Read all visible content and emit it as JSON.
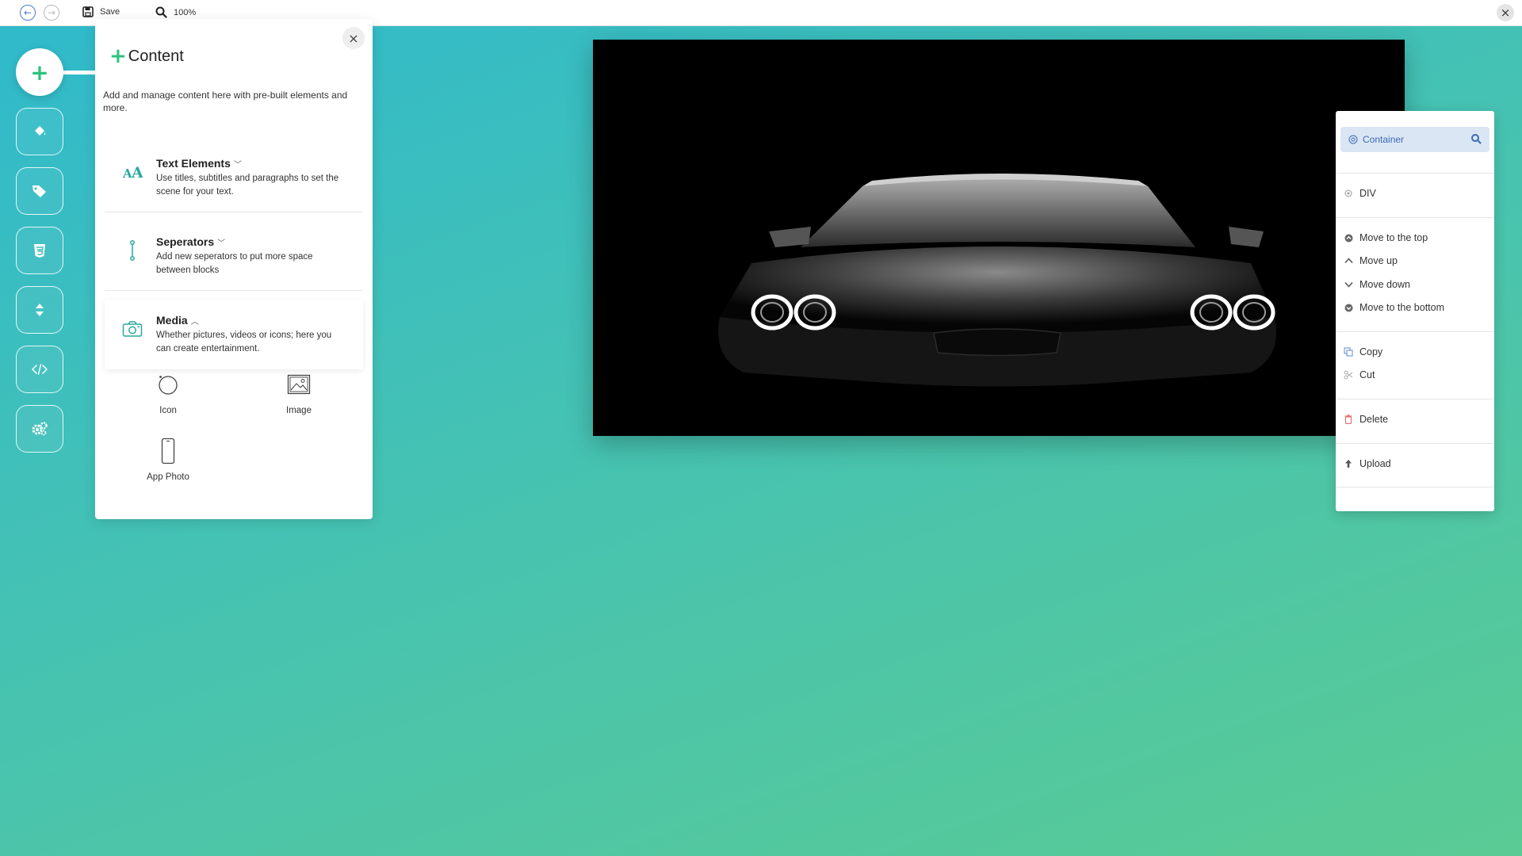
{
  "topbar": {
    "back_icon": "arrow-left-circle-icon",
    "forward_icon": "arrow-right-circle-icon",
    "save_label": "Save",
    "zoom_label": "100%",
    "close_icon": "close-icon"
  },
  "sidebar": {
    "add_icon": "plus-icon",
    "buttons": [
      {
        "name": "paint-bucket-icon"
      },
      {
        "name": "tag-icon"
      },
      {
        "name": "css-icon"
      },
      {
        "name": "sort-arrows-icon"
      },
      {
        "name": "code-icon"
      },
      {
        "name": "settings-gears-icon"
      }
    ]
  },
  "panel": {
    "title": "Content",
    "description": "Add and manage content here with pre-built elements and more.",
    "sections": [
      {
        "title": "Text Elements",
        "description": "Use titles, subtitles and paragraphs to set the scene for your text.",
        "icon": "text-aa-icon",
        "expanded": false
      },
      {
        "title": "Seperators",
        "description": "Add new seperators to put more space between blocks",
        "icon": "separator-icon",
        "expanded": false
      },
      {
        "title": "Media",
        "description": "Whether pictures, videos or icons; here you can create entertainment.",
        "icon": "camera-icon",
        "expanded": true
      }
    ],
    "media_items": [
      {
        "label": "Icon",
        "icon": "circle-icon"
      },
      {
        "label": "Image",
        "icon": "image-icon"
      },
      {
        "label": "App Photo",
        "icon": "phone-icon"
      }
    ]
  },
  "canvas": {
    "image_subject": "car-front-headlights-dark"
  },
  "context_menu": {
    "search_label": "Container",
    "element_type": "DIV",
    "items": [
      {
        "label": "Move to the top",
        "icon": "arrow-up-circle-icon"
      },
      {
        "label": "Move up",
        "icon": "chevron-up-icon"
      },
      {
        "label": "Move down",
        "icon": "chevron-down-icon"
      },
      {
        "label": "Move to the bottom",
        "icon": "arrow-down-circle-icon"
      },
      {
        "label": "Copy",
        "icon": "copy-icon"
      },
      {
        "label": "Cut",
        "icon": "scissors-icon"
      },
      {
        "label": "Delete",
        "icon": "trash-icon"
      },
      {
        "label": "Upload",
        "icon": "upload-icon"
      }
    ]
  },
  "colors": {
    "accent_green": "#2ec27e",
    "link_blue": "#4a7bd6",
    "bg_gradient_start": "#2fb9cc",
    "bg_gradient_end": "#5acb94",
    "delete_red": "#e57373"
  }
}
